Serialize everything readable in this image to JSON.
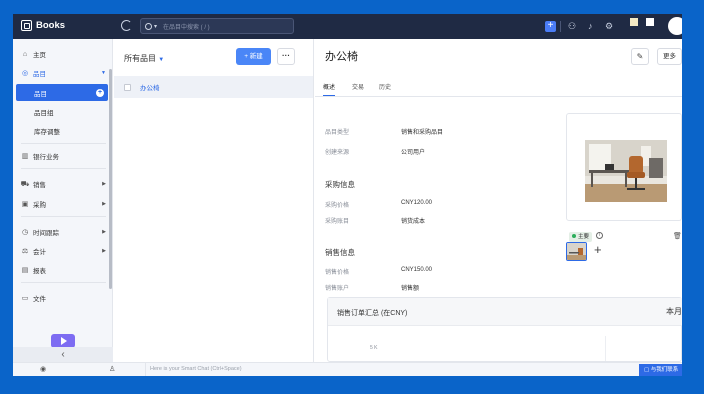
{
  "app": {
    "name": "Books"
  },
  "topbar": {
    "search_placeholder": "在品目中搜索 ( / )",
    "colors": {
      "bar": "#1f2a44",
      "accent": "#4a7cf6"
    }
  },
  "sidebar": {
    "items": [
      {
        "label": "主页",
        "icon": "home-icon"
      },
      {
        "label": "品目",
        "icon": "item-icon",
        "active": true
      },
      {
        "label": "品目",
        "sub": true,
        "selected": true
      },
      {
        "label": "品目组",
        "sub": true
      },
      {
        "label": "库存调整",
        "sub": true
      },
      {
        "label": "银行业务",
        "icon": "bank-icon"
      },
      {
        "label": "销售",
        "icon": "cart-icon"
      },
      {
        "label": "采购",
        "icon": "bag-icon"
      },
      {
        "label": "时间跟踪",
        "icon": "clock-icon"
      },
      {
        "label": "会计",
        "icon": "accounting-icon"
      },
      {
        "label": "报表",
        "icon": "chart-icon"
      },
      {
        "label": "文件",
        "icon": "folder-icon"
      }
    ],
    "collapse_glyph": "‹"
  },
  "list": {
    "view_label": "所有品目",
    "new_button": "+ 新建",
    "more_button": "···",
    "rows": [
      {
        "name": "办公椅"
      }
    ]
  },
  "detail": {
    "title": "办公椅",
    "more_label": "更多",
    "tabs": [
      "概述",
      "交易",
      "历史"
    ],
    "active_tab": 0,
    "fields": [
      {
        "label": "品目类型",
        "value": "销售和采购品目"
      },
      {
        "label": "创建来源",
        "value": "公司用户"
      }
    ],
    "purchase": {
      "title": "采购信息",
      "fields": [
        {
          "label": "采购价格",
          "value": "CNY120.00"
        },
        {
          "label": "采购账目",
          "value": "销货成本"
        }
      ]
    },
    "sales": {
      "title": "销售信息",
      "fields": [
        {
          "label": "销售价格",
          "value": "CNY150.00"
        },
        {
          "label": "销售账户",
          "value": "销售额"
        }
      ]
    },
    "image": {
      "primary_label": "主要"
    },
    "summary": {
      "title": "销售订单汇总 (在CNY)",
      "period": "本月",
      "tick": "5 K"
    }
  },
  "bottombar": {
    "chat_placeholder": "Here is your Smart Chat (Ctrl+Space)",
    "contact_label": "与我们联系"
  }
}
